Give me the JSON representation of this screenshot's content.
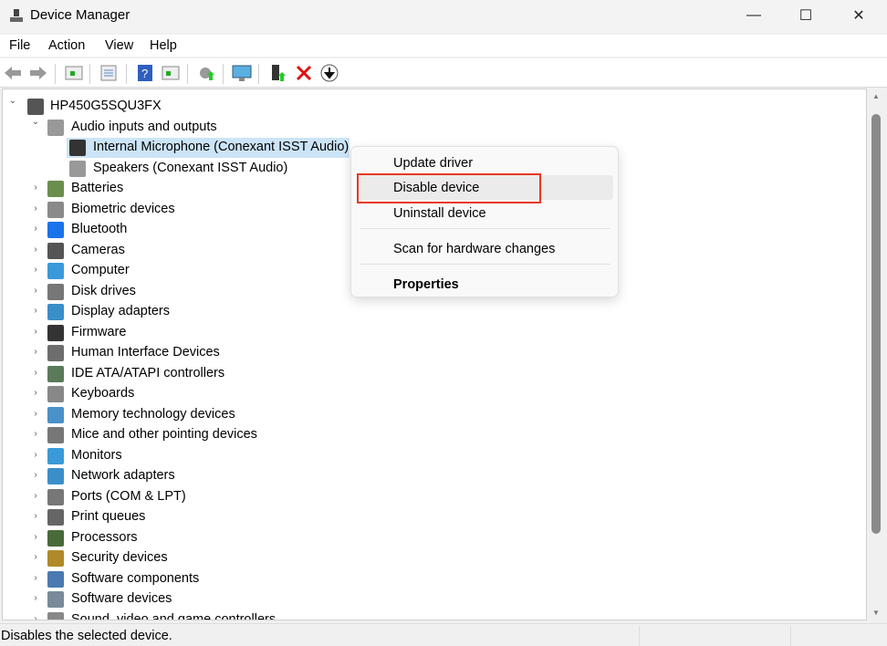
{
  "window": {
    "title": "Device Manager",
    "minimize": "—",
    "maximize": "☐",
    "close": "✕"
  },
  "menubar": [
    "File",
    "Action",
    "View",
    "Help"
  ],
  "toolbar": [
    "back-icon",
    "forward-icon",
    "show-hide-console-tree-icon",
    "properties-icon",
    "help-icon",
    "action-pane-icon",
    "update-driver-icon",
    "scan-hardware-icon",
    "enable-device-icon",
    "uninstall-device-icon",
    "disable-device-icon"
  ],
  "tree": {
    "root": "HP450G5SQU3FX",
    "expanded": {
      "label": "Audio inputs and outputs",
      "children": [
        "Internal Microphone (Conexant ISST Audio)",
        "Speakers (Conexant ISST Audio)"
      ]
    },
    "categories": [
      {
        "label": "Batteries",
        "color": "#6b8e4e"
      },
      {
        "label": "Biometric devices",
        "color": "#8a8a8a"
      },
      {
        "label": "Bluetooth",
        "color": "#1a73e8"
      },
      {
        "label": "Cameras",
        "color": "#555555"
      },
      {
        "label": "Computer",
        "color": "#3a9ad9"
      },
      {
        "label": "Disk drives",
        "color": "#777777"
      },
      {
        "label": "Display adapters",
        "color": "#3a8fc9"
      },
      {
        "label": "Firmware",
        "color": "#333333"
      },
      {
        "label": "Human Interface Devices",
        "color": "#6d6d6d"
      },
      {
        "label": "IDE ATA/ATAPI controllers",
        "color": "#5a7a5a"
      },
      {
        "label": "Keyboards",
        "color": "#888888"
      },
      {
        "label": "Memory technology devices",
        "color": "#4a90c9"
      },
      {
        "label": "Mice and other pointing devices",
        "color": "#777777"
      },
      {
        "label": "Monitors",
        "color": "#3a9ad9"
      },
      {
        "label": "Network adapters",
        "color": "#3a8fc9"
      },
      {
        "label": "Ports (COM & LPT)",
        "color": "#777777"
      },
      {
        "label": "Print queues",
        "color": "#666666"
      },
      {
        "label": "Processors",
        "color": "#4a6a3a"
      },
      {
        "label": "Security devices",
        "color": "#b08a2a"
      },
      {
        "label": "Software components",
        "color": "#4a7ab0"
      },
      {
        "label": "Software devices",
        "color": "#7a8a9a"
      },
      {
        "label": "Sound, video and game controllers",
        "color": "#888888"
      }
    ]
  },
  "context_menu": {
    "items": [
      "Update driver",
      "Disable device",
      "Uninstall device",
      "Scan for hardware changes",
      "Properties"
    ],
    "highlighted": "Disable device"
  },
  "status": "Disables the selected device.",
  "colors": {
    "highlight_border": "#e8381f",
    "selection": "#cce4f7"
  }
}
